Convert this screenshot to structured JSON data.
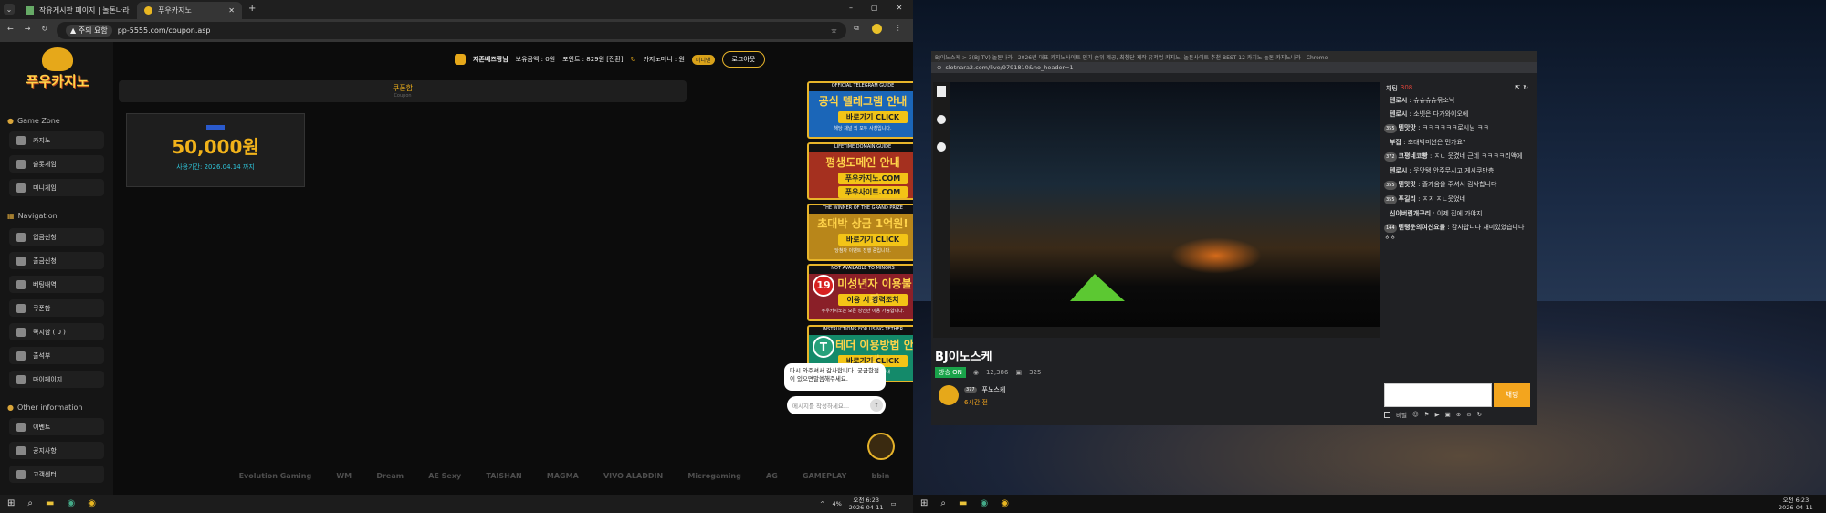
{
  "left_browser": {
    "tabs": [
      {
        "label": "작유게시판 페이지 | 놀톤나라"
      },
      {
        "label": "푸우카지노"
      }
    ],
    "security_label": "주의 요함",
    "url": "pp-5555.com/coupon.asp",
    "window_controls": [
      "–",
      "▢",
      "✕"
    ]
  },
  "site": {
    "logo_text": "푸우카지노",
    "header": {
      "user": "지존베즈짱님",
      "balance_label": "보유금액 : 0원",
      "point_label": "포인트 : 829원 [전환]",
      "casino_money_label": "카지노머니 : 원",
      "mini_btn": "미니맨",
      "logout_btn": "로그아웃"
    },
    "sections": {
      "game_zone": "Game Zone",
      "navigation": "Navigation",
      "other": "Other information"
    },
    "game_items": [
      {
        "label": "카지노"
      },
      {
        "label": "슬롯게임"
      },
      {
        "label": "미니게임"
      }
    ],
    "nav_items": [
      {
        "label": "입금신청"
      },
      {
        "label": "출금신청"
      },
      {
        "label": "베팅내역"
      },
      {
        "label": "쿠폰함"
      },
      {
        "label": "쪽지함 ( 0 )"
      },
      {
        "label": "출석부"
      },
      {
        "label": "마이페이지"
      }
    ],
    "other_items": [
      {
        "label": "이벤트"
      },
      {
        "label": "공지사항"
      },
      {
        "label": "고객센터"
      }
    ],
    "coupon": {
      "title": "쿠폰함",
      "subtitle": "Coupon",
      "amount": "50,000원",
      "expire": "사용기간: 2026.04.14 까지"
    },
    "banners": [
      {
        "top": "OFFICIAL TELEGRAM GUIDE",
        "main": "공식 텔레그램 안내",
        "btn": "바로가기 CLICK",
        "sub": "해당 채널 외 모두 사칭입니다."
      },
      {
        "top": "LIFETIME DOMAIN GUIDE",
        "main": "평생도메인 안내",
        "btn": "푸우카지노.COM",
        "sub": "푸우사이트.COM"
      },
      {
        "top": "THE WINNER OF THE GRAND PRIZE",
        "main": "초대박 상금 1억원!",
        "btn": "바로가기 CLICK",
        "sub": "당첨자 이벤트 진행 중입니다."
      },
      {
        "top": "NOT AVAILABLE TO MINORS",
        "main": "미성년자 이용불가",
        "btn": "이용 시 강력조치",
        "sub": "푸우카지노는 모든 성인만 이용 가능합니다."
      },
      {
        "top": "INSTRUCTIONS FOR USING TETHER",
        "main": "테더 이용방법 안내",
        "btn": "바로가기 CLICK",
        "sub": "초보자도 이해하기 쉬운 안내"
      }
    ],
    "chat_popup": {
      "message": "다시 와주셔서 감사합니다. 궁금한점이 있으면말씀해주세요.",
      "placeholder": "메시지를 작성하세요..."
    },
    "providers": [
      "Evolution Gaming",
      "WM",
      "Dream",
      "AE Sexy",
      "TAISHAN",
      "MAGMA",
      "VIVO ALADDIN",
      "Microgaming",
      "AG",
      "GAMEPLAY",
      "bbin"
    ]
  },
  "taskbar_left": {
    "time": "오전 6:23",
    "date": "2026-04-11",
    "tray": "4%"
  },
  "right_window": {
    "title": "BJ이노스케 > 3(BJ TV) 놀톤나라 - 2026년 대표 카지노사이트 인기 순위 제공, 최첨단 제작 유저업 카지노, 놀톤사이트 추천 BEST 12 카지노 놀톤 카지노나라 - Chrome",
    "url": "slotnara2.com/live/9791810&no_header=1",
    "channel": "BJ이노스케",
    "live_badge": "방송 ON",
    "viewers": "12,386",
    "comments": "325",
    "streamer": "푸노스케",
    "streamer_level": "377",
    "time_ago": "6시간 전",
    "chat_title": "채팅",
    "chat_count": "308",
    "chat_lines": [
      {
        "lvl": "",
        "user": "텐로시",
        "msg": "슈슈슈슈묶소닉"
      },
      {
        "lvl": "",
        "user": "텐로시",
        "msg": "소넷은 다가와이오에"
      },
      {
        "lvl": "355",
        "user": "텐맛맛",
        "msg": "ㅋㅋㅋㅋㅋㅋ로시님 ㅋㅋ"
      },
      {
        "lvl": "",
        "user": "부잡",
        "msg": "초대박미션은 먼가요?"
      },
      {
        "lvl": "372",
        "user": "코평네코빵",
        "msg": "ㅈㄴ 웃겼네 근데 ㅋㅋㅋㅋ리액에"
      },
      {
        "lvl": "",
        "user": "텐로시",
        "msg": "웃맛탱 안주무시고 게시쿠만층"
      },
      {
        "lvl": "355",
        "user": "텐맛맛",
        "msg": "즐거움을 주셔서 감사합니다"
      },
      {
        "lvl": "355",
        "user": "푸길리",
        "msg": "ㅈㅈ ㅈㄴ웃었네"
      },
      {
        "lvl": "",
        "user": "신이버린개구리",
        "msg": "이제 집에 가야지"
      },
      {
        "lvl": "144",
        "user": "텐탱운의여신요들",
        "msg": "감사합니다 재미있었습니다 ㅎㅎ"
      }
    ],
    "send_btn": "채팅",
    "secret_label": "비밀",
    "time": "오전 6:23",
    "date": "2026-04-11"
  },
  "colors": {
    "gold": "#f1b21a",
    "green": "#2aa84a",
    "orange": "#f3a51e",
    "red": "#e0443a"
  }
}
